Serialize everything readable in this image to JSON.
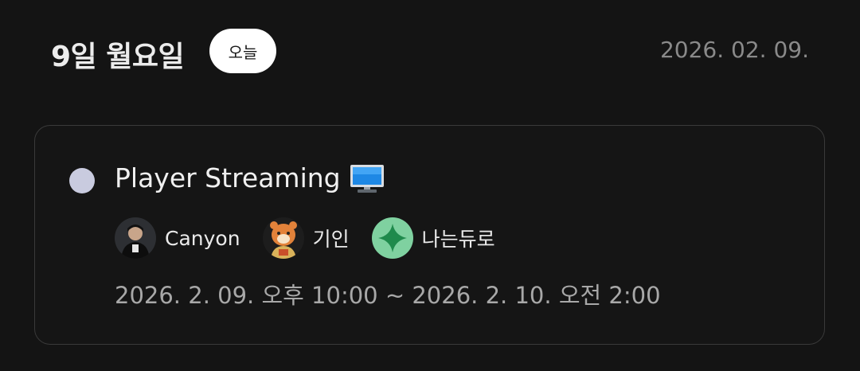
{
  "header": {
    "day_title": "9일 월요일",
    "today_badge": "오늘",
    "date": "2026. 02. 09."
  },
  "event": {
    "status_color": "#c9cbdf",
    "title": "Player Streaming",
    "title_icon": "desktop-monitor-icon",
    "participants": [
      {
        "name": "Canyon",
        "avatar": "canyon-avatar"
      },
      {
        "name": "기인",
        "avatar": "tiger-mascot-avatar"
      },
      {
        "name": "나는듀로",
        "avatar": "green-sparkle-avatar"
      }
    ],
    "time_range": "2026. 2. 09. 오후 10:00 ~ 2026. 2. 10. 오전 2:00"
  }
}
